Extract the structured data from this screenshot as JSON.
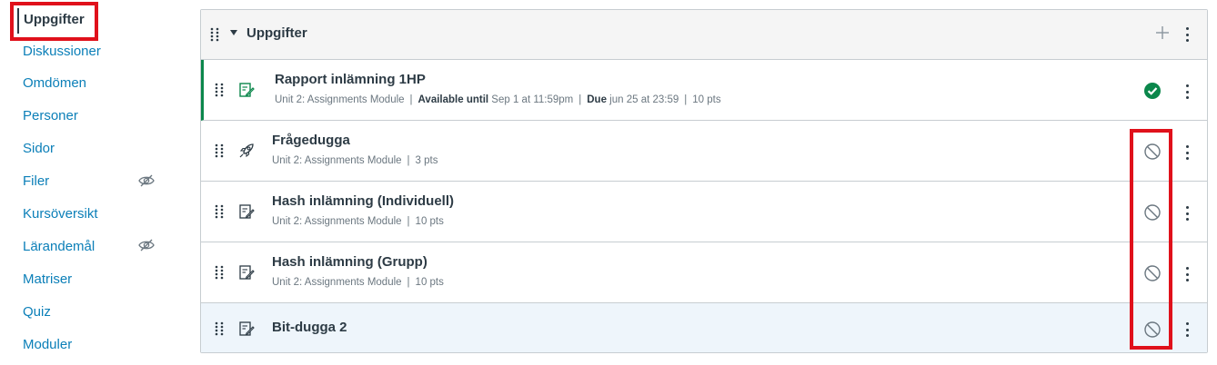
{
  "sidebar": {
    "items": [
      {
        "label": "Uppgifter",
        "active": true
      },
      {
        "label": "Diskussioner"
      },
      {
        "label": "Omdömen"
      },
      {
        "label": "Personer"
      },
      {
        "label": "Sidor"
      },
      {
        "label": "Filer",
        "hidden_icon": "eye-slash-icon"
      },
      {
        "label": "Kursöversikt"
      },
      {
        "label": "Lärandemål",
        "hidden_icon": "eye-slash-icon"
      },
      {
        "label": "Matriser"
      },
      {
        "label": "Quiz"
      },
      {
        "label": "Moduler"
      }
    ]
  },
  "group": {
    "title": "Uppgifter",
    "icons": [
      "drag-handle-icon",
      "caret-down-icon",
      "plus-icon",
      "kebab-menu-icon"
    ]
  },
  "assignments": [
    {
      "title": "Rapport inlämning 1HP",
      "type_icon": "assignment-icon",
      "module": "Unit 2: Assignments Module",
      "available_label": "Available until",
      "available_value": "Sep 1 at 11:59pm",
      "due_label": "Due",
      "due_value": "jun 25 at 23:59",
      "points": "10 pts",
      "status": "published",
      "status_icon": "check-circle-icon"
    },
    {
      "title": "Frågedugga",
      "type_icon": "quiz-rocket-icon",
      "module": "Unit 2: Assignments Module",
      "points": "3 pts",
      "status": "unpublished",
      "status_icon": "unpublished-circle-icon"
    },
    {
      "title": "Hash inlämning (Individuell)",
      "type_icon": "assignment-icon",
      "module": "Unit 2: Assignments Module",
      "points": "10 pts",
      "status": "unpublished",
      "status_icon": "unpublished-circle-icon"
    },
    {
      "title": "Hash inlämning (Grupp)",
      "type_icon": "assignment-icon",
      "module": "Unit 2: Assignments Module",
      "points": "10 pts",
      "status": "unpublished",
      "status_icon": "unpublished-circle-icon"
    },
    {
      "title": "Bit-dugga 2",
      "type_icon": "assignment-icon",
      "status": "unpublished",
      "status_icon": "unpublished-circle-icon"
    }
  ],
  "colors": {
    "link": "#0b7fb8",
    "text": "#2d3b45",
    "published": "#0b874b",
    "annotation": "#e0111b",
    "highlight_row": "#eef5fb"
  }
}
